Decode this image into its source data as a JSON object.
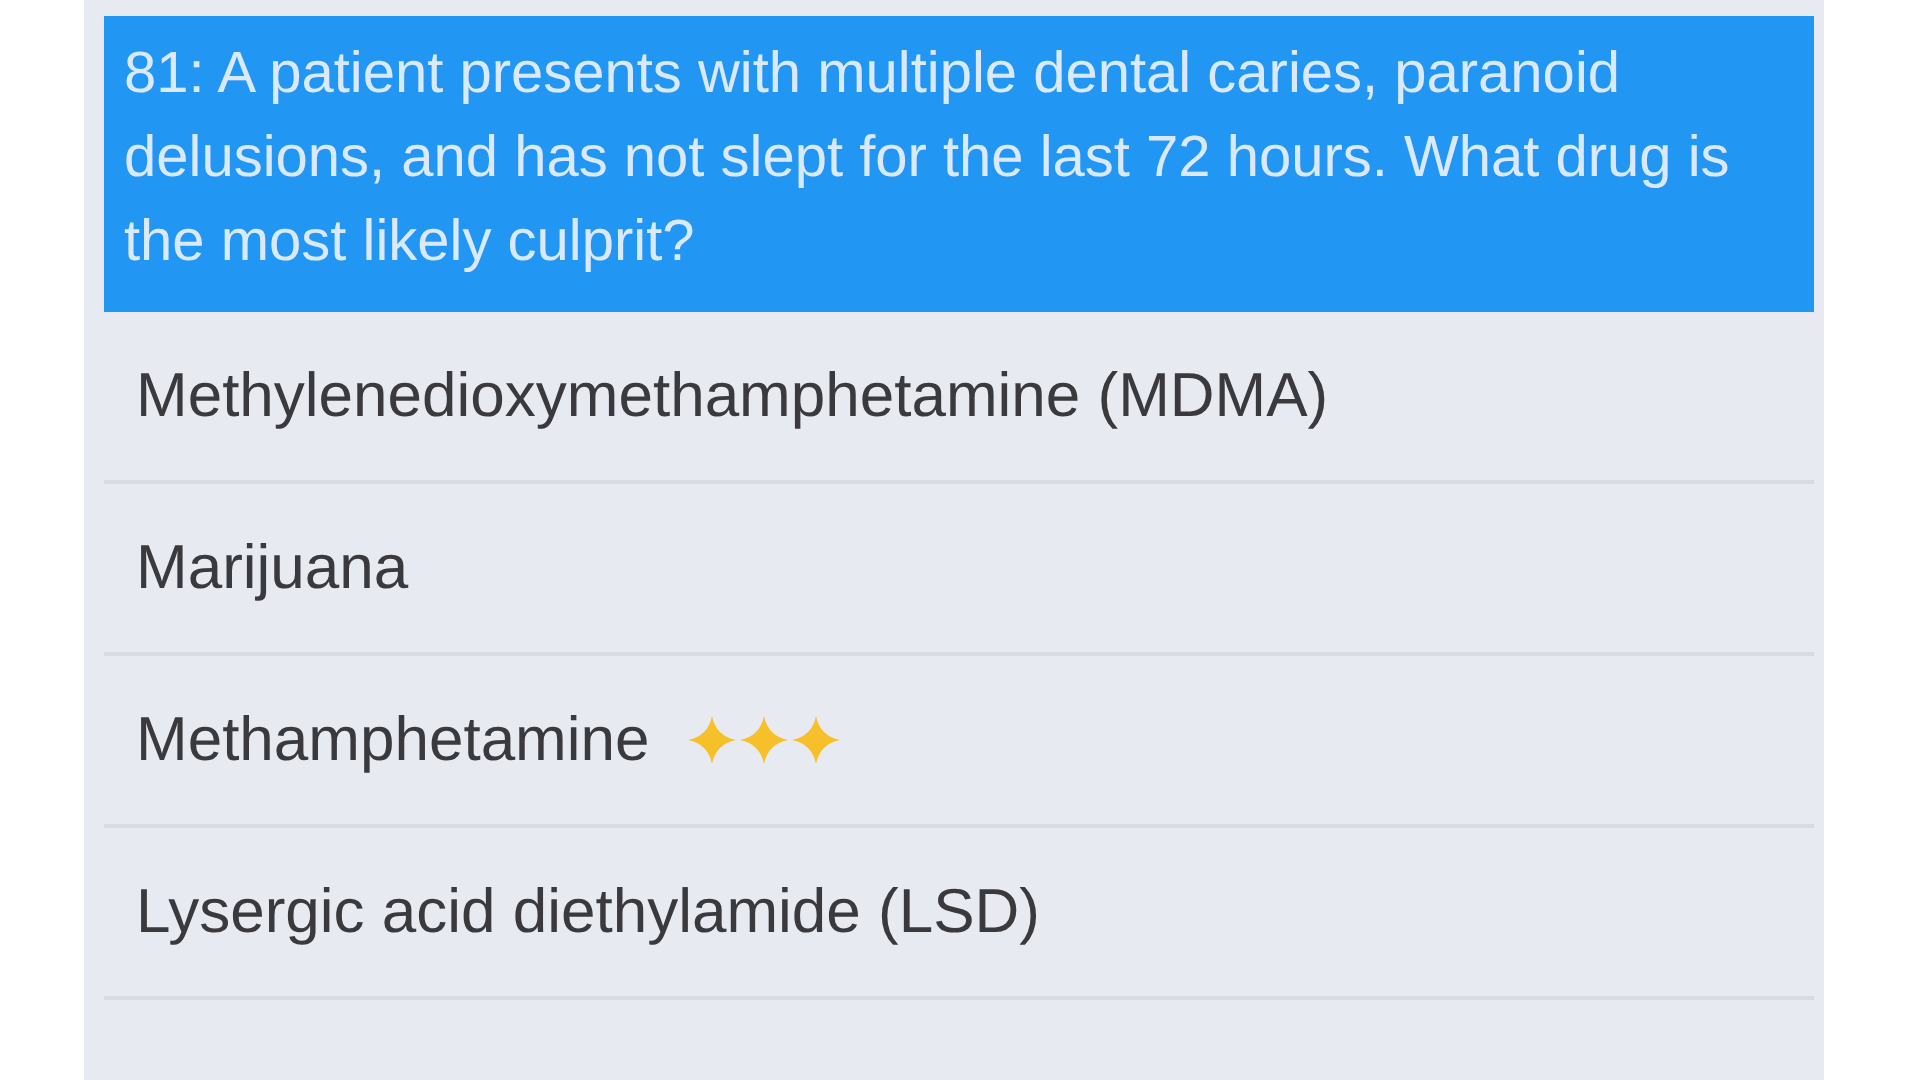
{
  "question": "81: A patient presents with multiple dental caries, paranoid delusions, and has not slept for the last 72 hours. What drug is the most likely culprit?",
  "answers": [
    {
      "text": "Methylenedioxymethamphetamine (MDMA)",
      "correct": false
    },
    {
      "text": "Marijuana",
      "correct": false
    },
    {
      "text": "Methamphetamine",
      "correct": true
    },
    {
      "text": "Lysergic acid diethylamide (LSD)",
      "correct": false
    }
  ]
}
